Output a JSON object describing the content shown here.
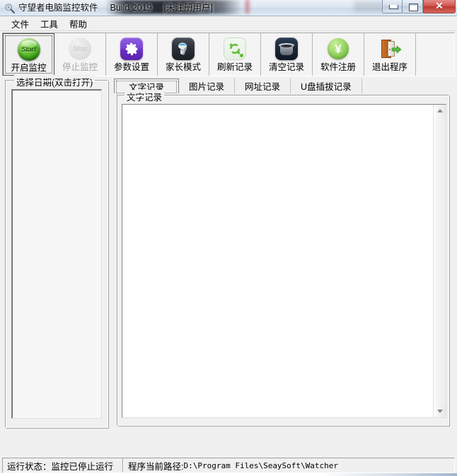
{
  "window": {
    "title_main": "守望者电脑监控软件",
    "title_build": "Build 2019",
    "title_license": "[未注册用户]",
    "app_icon_name": "magnifier-icon",
    "buttons": {
      "minimize": "minimize-button",
      "maximize": "maximize-button",
      "close_glyph": "✕"
    }
  },
  "menubar": {
    "items": [
      {
        "label": "文件"
      },
      {
        "label": "工具"
      },
      {
        "label": "帮助"
      }
    ]
  },
  "toolbar": {
    "buttons": [
      {
        "label": "开启监控",
        "icon": "start-green-circle-icon",
        "icon_text": "Start",
        "state": "focused",
        "enabled": true
      },
      {
        "label": "停止监控",
        "icon": "stop-grey-circle-icon",
        "icon_text": "Stop",
        "state": "normal",
        "enabled": false
      },
      {
        "label": "参数设置",
        "icon": "gear-purple-icon",
        "state": "normal",
        "enabled": true
      },
      {
        "label": "家长模式",
        "icon": "robot-dark-icon",
        "state": "normal",
        "enabled": true
      },
      {
        "label": "刷新记录",
        "icon": "refresh-green-icon",
        "state": "normal",
        "enabled": true
      },
      {
        "label": "清空记录",
        "icon": "trash-can-icon",
        "state": "normal",
        "enabled": true
      },
      {
        "label": "软件注册",
        "icon": "yen-green-circle-icon",
        "icon_text": "¥",
        "state": "normal",
        "enabled": true
      },
      {
        "label": "退出程序",
        "icon": "exit-door-icon",
        "state": "normal",
        "enabled": true
      }
    ]
  },
  "left_panel": {
    "group_label": "选择日期(双击打开)",
    "list_items": []
  },
  "tabs": [
    {
      "label": "文字记录",
      "selected": true
    },
    {
      "label": "图片记录",
      "selected": false
    },
    {
      "label": "网址记录",
      "selected": false
    },
    {
      "label": "U盘插拔记录",
      "selected": false
    }
  ],
  "record_panel": {
    "group_label": "文字记录",
    "text_content": ""
  },
  "statusbar": {
    "run_state": "运行状态：监控已停止运行",
    "path_label": "程序当前路径:",
    "path_value": "D:\\Program Files\\SeaySoft\\Watcher"
  },
  "colors": {
    "window_bg": "#f0f0f0",
    "close_button": "#c4453d",
    "start_green": "#5fc32c",
    "gear_purple": "#7b44d6",
    "yen_green": "#9ed96a"
  }
}
